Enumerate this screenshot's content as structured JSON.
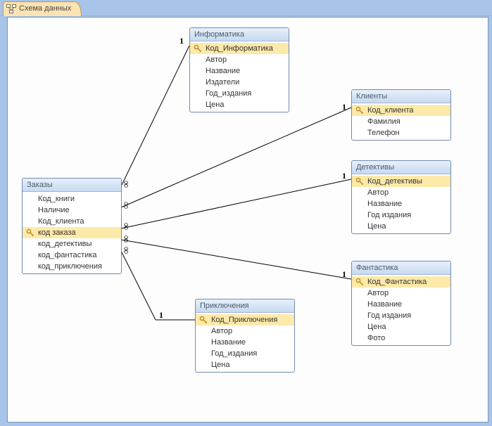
{
  "tab": {
    "title": "Схема данных"
  },
  "tables": {
    "zakazy": {
      "title": "Заказы",
      "fields": [
        {
          "name": "Код_книги",
          "pk": false
        },
        {
          "name": "Наличие",
          "pk": false
        },
        {
          "name": "Код_клиента",
          "pk": false
        },
        {
          "name": "код заказа",
          "pk": true
        },
        {
          "name": "код_детективы",
          "pk": false
        },
        {
          "name": "код_фантастика",
          "pk": false
        },
        {
          "name": "код_приключения",
          "pk": false
        }
      ]
    },
    "informatika": {
      "title": "Информатика",
      "fields": [
        {
          "name": "Код_Информатика",
          "pk": true
        },
        {
          "name": "Автор",
          "pk": false
        },
        {
          "name": "Название",
          "pk": false
        },
        {
          "name": "Издатели",
          "pk": false
        },
        {
          "name": "Год_издания",
          "pk": false
        },
        {
          "name": "Цена",
          "pk": false
        }
      ]
    },
    "klienty": {
      "title": "Клиенты",
      "fields": [
        {
          "name": "Код_клиента",
          "pk": true
        },
        {
          "name": "Фамилия",
          "pk": false
        },
        {
          "name": "Телефон",
          "pk": false
        }
      ]
    },
    "detektivy": {
      "title": "Детективы",
      "fields": [
        {
          "name": "Код_детективы",
          "pk": true
        },
        {
          "name": "Автор",
          "pk": false
        },
        {
          "name": "Название",
          "pk": false
        },
        {
          "name": "Год издания",
          "pk": false
        },
        {
          "name": "Цена",
          "pk": false
        }
      ]
    },
    "fantastika": {
      "title": "Фантастика",
      "fields": [
        {
          "name": "Код_Фантастика",
          "pk": true
        },
        {
          "name": "Автор",
          "pk": false
        },
        {
          "name": "Название",
          "pk": false
        },
        {
          "name": "Год издания",
          "pk": false
        },
        {
          "name": "Цена",
          "pk": false
        },
        {
          "name": "Фото",
          "pk": false
        }
      ]
    },
    "priklyucheniya": {
      "title": "Приключения",
      "fields": [
        {
          "name": "Код_Приключения",
          "pk": true
        },
        {
          "name": "Автор",
          "pk": false
        },
        {
          "name": "Название",
          "pk": false
        },
        {
          "name": "Год_издания",
          "pk": false
        },
        {
          "name": "Цена",
          "pk": false
        }
      ]
    }
  },
  "relationships": [
    {
      "from": "zakazy",
      "to": "informatika",
      "from_card": "∞",
      "to_card": "1"
    },
    {
      "from": "zakazy",
      "to": "klienty",
      "from_card": "∞",
      "to_card": "1"
    },
    {
      "from": "zakazy",
      "to": "detektivy",
      "from_card": "∞",
      "to_card": "1"
    },
    {
      "from": "zakazy",
      "to": "fantastika",
      "from_card": "∞",
      "to_card": "1"
    },
    {
      "from": "zakazy",
      "to": "priklyucheniya",
      "from_card": "∞",
      "to_card": "1"
    }
  ]
}
